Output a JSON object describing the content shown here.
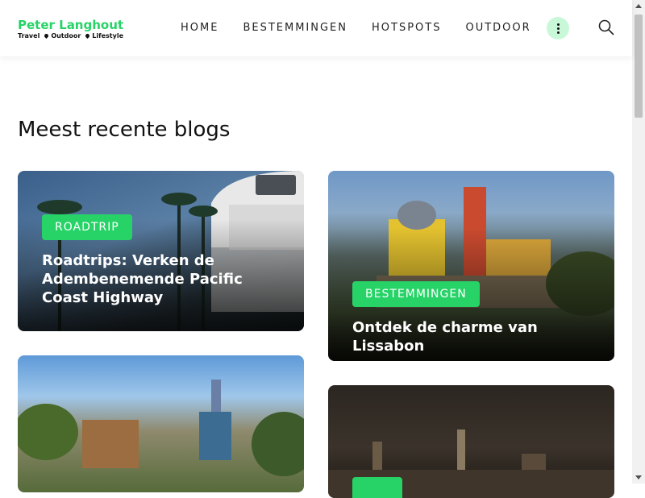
{
  "brand": {
    "title": "Peter Langhout",
    "tags": [
      "Travel",
      "Outdoor",
      "Lifestyle"
    ],
    "accent": "#27d367"
  },
  "nav": [
    "HOME",
    "BESTEMMINGEN",
    "HOTSPOTS",
    "OUTDOOR"
  ],
  "icons": {
    "more": "more-vertical-icon",
    "search": "search-icon"
  },
  "section": {
    "title": "Meest recente blogs"
  },
  "cards": [
    {
      "tag": "ROADTRIP",
      "title": "Roadtrips: Verken de Adembenemende Pacific Coast Highway"
    },
    {
      "tag": "BESTEMMINGEN",
      "title": "Ontdek de charme van Lissabon"
    },
    {
      "tag": "",
      "title": ""
    },
    {
      "tag": "",
      "title": ""
    }
  ]
}
